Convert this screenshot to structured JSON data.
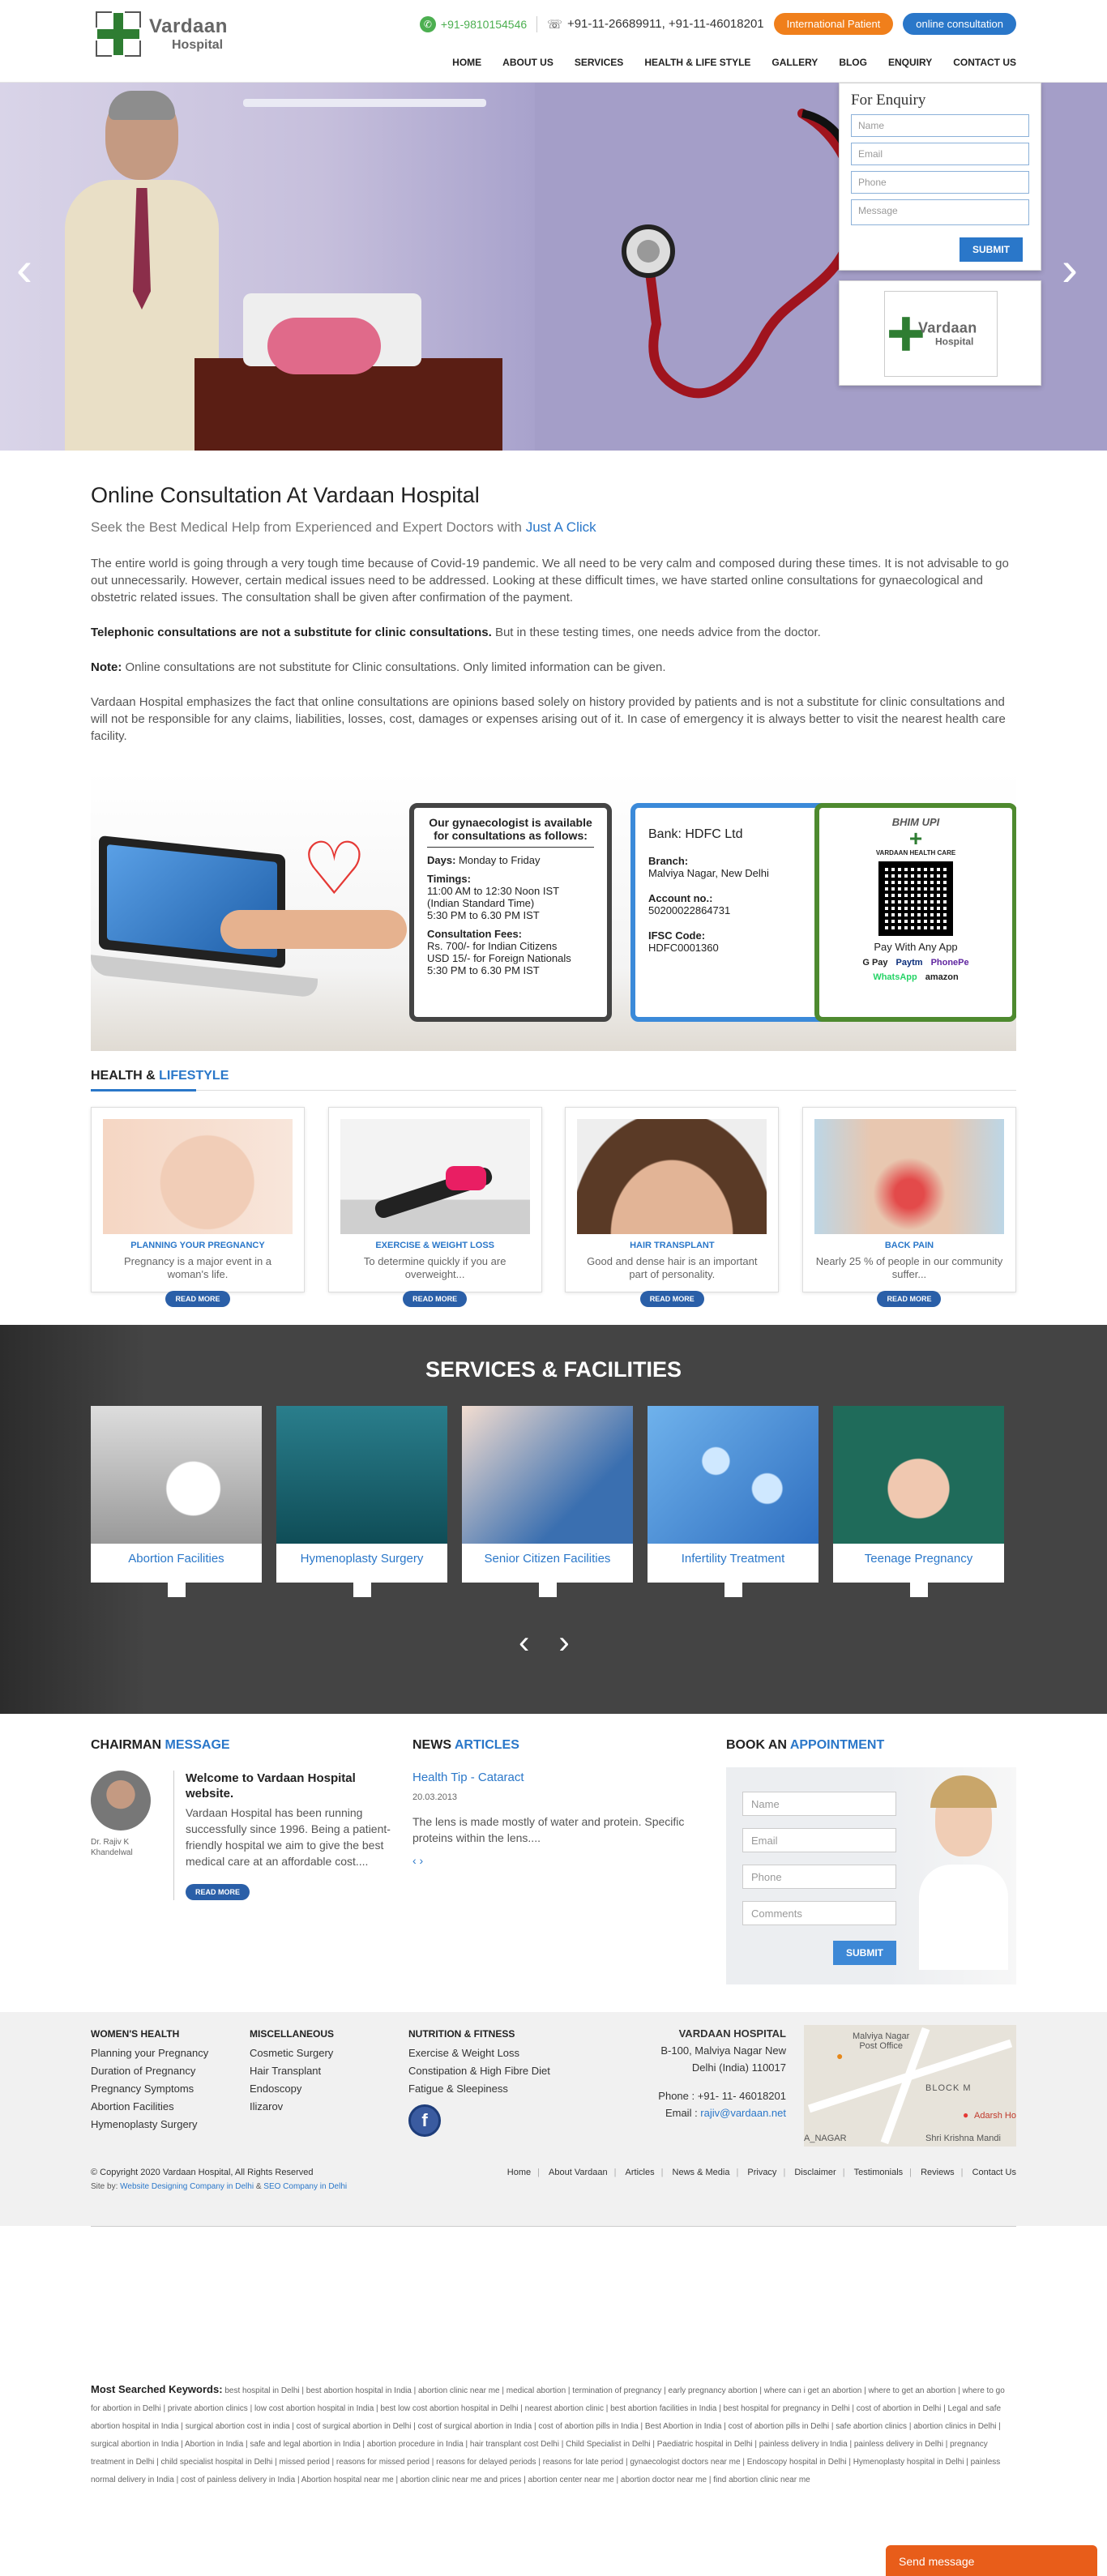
{
  "header": {
    "logo_name": "Vardaan",
    "logo_sub": "Hospital",
    "whatsapp": "+91-9810154546",
    "phone": "+91-11-26689911, +91-11-46018201",
    "btn_international": "International Patient",
    "btn_online": "online consultation",
    "nav": [
      "HOME",
      "ABOUT US",
      "SERVICES",
      "HEALTH & LIFE STYLE",
      "GALLERY",
      "BLOG",
      "ENQUIRY",
      "CONTACT US"
    ]
  },
  "enquiry": {
    "title": "For Enquiry",
    "name_ph": "Name",
    "email_ph": "Email",
    "phone_ph": "Phone",
    "message_ph": "Message",
    "submit": "SUBMIT"
  },
  "consult": {
    "title": "Online Consultation At Vardaan Hospital",
    "sub_a": "Seek the Best Medical Help from Experienced and Expert Doctors with ",
    "sub_b": "Just A Click",
    "p1": "The entire world is going through a very tough time because of Covid-19 pandemic. We all need to be very calm and composed during these times. It is not advisable to go out unnecessarily. However, certain medical issues need to be addressed. Looking at these difficult times, we have started online consultations for gynaecological and obstetric related issues. The consultation shall be given after confirmation of the payment.",
    "p2_b": "Telephonic consultations are not a substitute for clinic consultations.",
    "p2": " But in these testing times, one needs advice from the doctor.",
    "p3_b": "Note:",
    "p3": " Online consultations are not substitute for Clinic consultations. Only limited information can be given.",
    "p4": "Vardaan Hospital emphasizes the fact that online consultations are opinions based solely on history provided by patients and is not a substitute for clinic consultations and will not be responsible for any claims, liabilities, losses, cost, damages or expenses arising out of it. In case of emergency it is always better to visit the nearest health care facility."
  },
  "schedule": {
    "heading": "Our gynaecologist is available for consultations as follows:",
    "days_l": "Days:",
    "days": " Monday to Friday",
    "timings_l": "Timings:",
    "t1": "11:00 AM to 12:30 Noon IST",
    "t2": "(Indian Standard Time)",
    "t3": "5:30 PM to 6.30 PM IST",
    "fees_l": "Consultation Fees:",
    "f1": "Rs. 700/- for Indian Citizens",
    "f2": "USD 15/- for Foreign Nationals",
    "f3": "5:30 PM to 6.30 PM IST"
  },
  "bank": {
    "name": "Bank: HDFC Ltd",
    "branch_l": "Branch:",
    "branch": "Malviya Nagar, New Delhi",
    "acc_l": "Account no.:",
    "acc": "50200022864731",
    "ifsc_l": "IFSC Code:",
    "ifsc": "HDFC0001360"
  },
  "upi": {
    "title": "BHIM UPI",
    "org": "VARDAAN HEALTH CARE",
    "pay": "Pay With Any App",
    "apps": [
      "G Pay",
      "Paytm",
      "PhonePe"
    ],
    "apps2": [
      "WhatsApp",
      "amazon"
    ]
  },
  "health": {
    "title_a": "HEALTH & ",
    "title_b": "LIFESTYLE",
    "read_more": "READ MORE",
    "items": [
      {
        "title": "PLANNING YOUR PREGNANCY",
        "desc": "Pregnancy is a major event in a woman's life."
      },
      {
        "title": "EXERCISE & WEIGHT LOSS",
        "desc": "To determine quickly if you are overweight..."
      },
      {
        "title": "HAIR TRANSPLANT",
        "desc": "Good and dense hair is an important part of personality."
      },
      {
        "title": "BACK PAIN",
        "desc": "Nearly 25 % of people in our community suffer..."
      }
    ]
  },
  "services": {
    "title": "SERVICES & FACILITIES",
    "items": [
      "Abortion Facilities",
      "Hymenoplasty Surgery",
      "Senior Citizen Facilities",
      "Infertility Treatment",
      "Teenage Pregnancy"
    ]
  },
  "chairman": {
    "title_a": "CHAIRMAN ",
    "title_b": "MESSAGE",
    "name": "Dr. Rajiv K Khandelwal",
    "welcome": "Welcome to Vardaan Hospital website.",
    "desc": "Vardaan Hospital has been running successfully since 1996. Being a patient-friendly hospital we aim to give the best medical care at an affordable cost....",
    "read_more": "READ MORE"
  },
  "news": {
    "title_a": "NEWS ",
    "title_b": "ARTICLES",
    "item_title": "Health Tip - Cataract",
    "date": "20.03.2013",
    "desc": "The lens is made mostly of water and protein. Specific proteins within the lens....",
    "arrows": "‹ ›"
  },
  "appointment": {
    "title_a": "BOOK AN ",
    "title_b": "APPOINTMENT",
    "name_ph": "Name",
    "email_ph": "Email",
    "phone_ph": "Phone",
    "comments_ph": "Comments",
    "submit": "SUBMIT"
  },
  "footer": {
    "women_title": "WOMEN'S HEALTH",
    "women": [
      "Planning your Pregnancy",
      "Duration of Pregnancy",
      "Pregnancy Symptoms",
      "Abortion Facilities",
      "Hymenoplasty Surgery"
    ],
    "misc_title": "MISCELLANEOUS",
    "misc": [
      "Cosmetic Surgery",
      "Hair Transplant",
      "Endoscopy",
      "Ilizarov"
    ],
    "nutrition_title": "NUTRITION & FITNESS",
    "nutrition": [
      "Exercise & Weight Loss",
      "Constipation & High Fibre Diet",
      "Fatigue & Sleepiness"
    ],
    "hospital_title": "VARDAAN HOSPITAL",
    "addr1": "B-100, Malviya Nagar New",
    "addr2": "Delhi (India) 110017",
    "phone": "Phone : +91- 11- 46018201",
    "email_l": "Email : ",
    "email": "rajiv@vardaan.net",
    "map_labels": [
      "Malviya Nagar",
      "Post Office",
      "BLOCK M",
      "A_NAGAR",
      "Shri Krishna Mandi",
      "Adarsh Ho"
    ],
    "copyright": "© Copyright 2020 Vardaan Hospital, All Rights Reserved",
    "site_a": "Site by: ",
    "site_b": "Website Designing Company in Delhi",
    "site_c": " & ",
    "site_d": "SEO Company in Delhi",
    "links": [
      "Home",
      "About Vardaan",
      "Articles",
      "News & Media",
      "Privacy",
      "Disclaimer",
      "Testimonials",
      "Reviews",
      "Contact Us"
    ]
  },
  "keywords": {
    "label": "Most Searched Keywords:",
    "text": "best hospital in Delhi | best abortion hospital in India | abortion clinic near me | medical abortion | termination of pregnancy | early pregnancy abortion | where can i get an abortion | where to get an abortion | where to go for abortion in Delhi | private abortion clinics | low cost abortion hospital in India | best low cost abortion hospital in Delhi | nearest abortion clinic | best abortion facilities in India | best hospital for pregnancy in Delhi | cost of abortion in Delhi | Legal and safe abortion hospital in India | surgical abortion cost in india | cost of surgical abortion in Delhi | cost of surgical abortion in India | cost of abortion pills in India | Best Abortion in India | cost of abortion pills in Delhi | safe abortion clinics | abortion clinics in Delhi | surgical abortion in India | Abortion in India | safe and legal abortion in India | abortion procedure in India | hair transplant cost Delhi | Child Specialist in Delhi | Paediatric hospital in Delhi | painless delivery in India | painless delivery in Delhi | pregnancy treatment in Delhi | child specialist hospital in Delhi | missed period | reasons for missed period | reasons for delayed periods | reasons for late period | gynaecologist doctors near me | Endoscopy hospital in Delhi | Hymenoplasty hospital in Delhi | painless normal delivery in India | cost of painless delivery in India | Abortion hospital near me | abortion clinic near me and prices | abortion center near me | abortion doctor near me | find abortion clinic near me"
  },
  "send_message": "Send message"
}
